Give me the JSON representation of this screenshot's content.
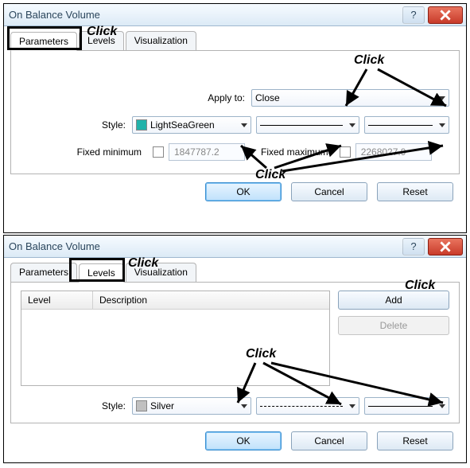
{
  "dialog1": {
    "title": "On Balance Volume",
    "tabs": {
      "parameters": "Parameters",
      "levels": "Levels",
      "visualization": "Visualization"
    },
    "apply_label": "Apply to:",
    "apply_value": "Close",
    "style_label": "Style:",
    "style_color_value": "LightSeaGreen",
    "style_color_hex": "#20b2aa",
    "fixed_min_label": "Fixed minimum",
    "fixed_min_value": "1847787.2",
    "fixed_max_label": "Fixed maximum",
    "fixed_max_value": "2268027.9",
    "ok": "OK",
    "cancel": "Cancel",
    "reset": "Reset"
  },
  "dialog2": {
    "title": "On Balance Volume",
    "tabs": {
      "parameters": "Parameters",
      "levels": "Levels",
      "visualization": "Visualization"
    },
    "col_level": "Level",
    "col_description": "Description",
    "add": "Add",
    "delete": "Delete",
    "style_label": "Style:",
    "style_color_value": "Silver",
    "style_color_hex": "#c0c0c0",
    "ok": "OK",
    "cancel": "Cancel",
    "reset": "Reset"
  },
  "annotations": {
    "click": "Click"
  }
}
